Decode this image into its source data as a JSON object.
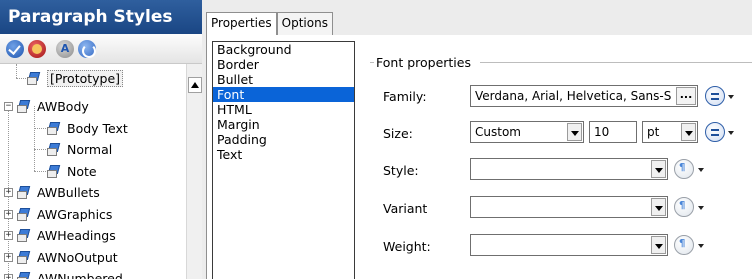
{
  "left_panel": {
    "title": "Paragraph Styles",
    "toolbar": [
      "check-icon",
      "remove-icon",
      "rename-icon",
      "refresh-icon"
    ],
    "tree": [
      {
        "label": "[Prototype]",
        "level": 1,
        "expander": null,
        "selected": true
      },
      {
        "label": "AWBody",
        "level": 0,
        "expander": "−"
      },
      {
        "label": "Body Text",
        "level": 1,
        "expander": null
      },
      {
        "label": "Normal",
        "level": 1,
        "expander": null
      },
      {
        "label": "Note",
        "level": 1,
        "expander": null
      },
      {
        "label": "AWBullets",
        "level": 0,
        "expander": "+"
      },
      {
        "label": "AWGraphics",
        "level": 0,
        "expander": "+"
      },
      {
        "label": "AWHeadings",
        "level": 0,
        "expander": "+"
      },
      {
        "label": "AWNoOutput",
        "level": 0,
        "expander": "+"
      },
      {
        "label": "AWNumbered",
        "level": 0,
        "expander": "+"
      }
    ]
  },
  "tabs": [
    {
      "label": "Properties",
      "active": true
    },
    {
      "label": "Options",
      "active": false
    }
  ],
  "categories": {
    "items": [
      "Background",
      "Border",
      "Bullet",
      "Font",
      "HTML",
      "Margin",
      "Padding",
      "Text"
    ],
    "selected": "Font"
  },
  "font_properties": {
    "group_title": "Font properties",
    "family": {
      "label": "Family:",
      "value": "Verdana, Arial, Helvetica, Sans-S",
      "ellipsis": "..."
    },
    "size": {
      "label": "Size:",
      "preset": "Custom",
      "number": "10",
      "unit": "pt"
    },
    "style": {
      "label": "Style:",
      "value": ""
    },
    "variant": {
      "label": "Variant",
      "value": ""
    },
    "weight": {
      "label": "Weight:",
      "value": ""
    }
  },
  "colors": {
    "title_bar": "#1a4684",
    "selection": "#0a64d8"
  }
}
